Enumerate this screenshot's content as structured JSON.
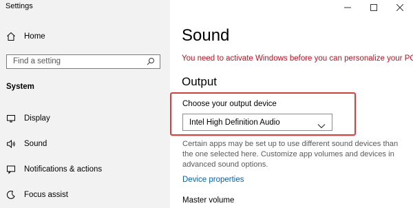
{
  "window": {
    "title": "Settings"
  },
  "sidebar": {
    "home": {
      "label": "Home",
      "icon": "home-icon"
    },
    "search": {
      "placeholder": "Find a setting",
      "icon": "search-icon"
    },
    "section_label": "System",
    "items": [
      {
        "label": "Display",
        "icon": "display-icon"
      },
      {
        "label": "Sound",
        "icon": "speaker-icon"
      },
      {
        "label": "Notifications & actions",
        "icon": "notifications-icon"
      },
      {
        "label": "Focus assist",
        "icon": "focus-assist-icon"
      }
    ]
  },
  "main": {
    "title": "Sound",
    "activation_warning": "You need to activate Windows before you can personalize your PC.",
    "output": {
      "heading": "Output",
      "device_label": "Choose your output device",
      "selected_device": "Intel High Definition Audio",
      "description": "Certain apps may be set up to use different sound devices than the one selected here. Customize app volumes and devices in advanced sound options.",
      "device_properties_link": "Device properties",
      "master_volume_label": "Master volume"
    }
  },
  "colors": {
    "sidebar_bg": "#f2f2f2",
    "warning": "#c50f1f",
    "link": "#0063b1",
    "highlight": "#e53935"
  }
}
